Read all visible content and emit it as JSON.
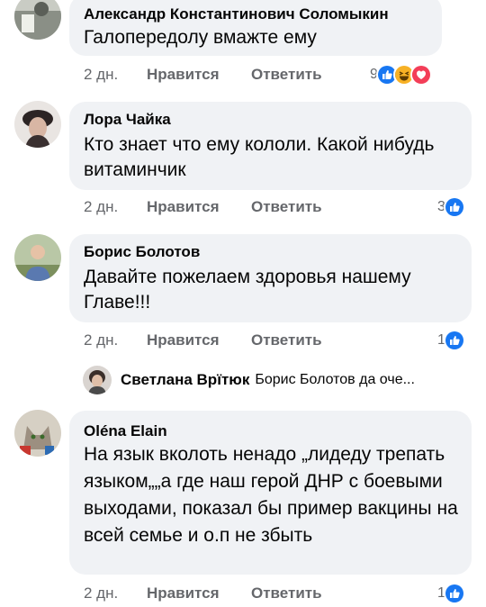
{
  "actions": {
    "like_label": "Нравится",
    "reply_label": "Ответить"
  },
  "comments": [
    {
      "author": "Александр Константинович Соломыкин",
      "text": "Галопередолу вмажте ему",
      "time": "2 дн.",
      "reaction_count": "9",
      "reactions": [
        "like-reaction-icon",
        "haha-reaction-icon",
        "love-reaction-icon"
      ]
    },
    {
      "author": "Лора Чайка",
      "text": "Кто знает что ему кололи. Какой нибудь витаминчик",
      "time": "2 дн.",
      "reaction_count": "3",
      "reactions": [
        "like-reaction-icon"
      ]
    },
    {
      "author": "Борис Болотов",
      "text": "Давайте пожелаем здоровья нашему Главе!!!",
      "time": "2 дн.",
      "reaction_count": "1",
      "reactions": [
        "like-reaction-icon"
      ]
    },
    {
      "author": "Oléna Elain",
      "text": "На язык вколоть ненадо „лидеду трепать языком„„а где наш герой ДНР с боевыми выходами, показал бы пример вакцины на всей семье и о.п не збыть",
      "time": "2 дн.",
      "reaction_count": "1",
      "reactions": [
        "like-reaction-icon"
      ]
    }
  ],
  "reply_preview": {
    "author": "Светлана Врїтюк",
    "text": "Борис Болотов да оче..."
  },
  "colors": {
    "bubble": "#f0f2f5",
    "secondary_text": "#65676b",
    "like_blue": "#1877f2",
    "love_red": "#f33e58",
    "haha_yellow": "#f7b125"
  }
}
